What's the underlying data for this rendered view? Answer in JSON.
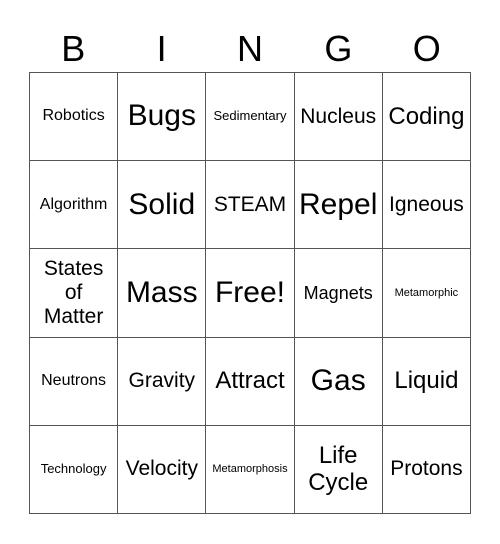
{
  "header": [
    "B",
    "I",
    "N",
    "G",
    "O"
  ],
  "cells": [
    {
      "text": "Robotics",
      "size": "s-md"
    },
    {
      "text": "Bugs",
      "size": "s-xxl"
    },
    {
      "text": "Sedimentary",
      "size": "s-sm"
    },
    {
      "text": "Nucleus",
      "size": "s-lg"
    },
    {
      "text": "Coding",
      "size": "s-xl"
    },
    {
      "text": "Algorithm",
      "size": "s-md"
    },
    {
      "text": "Solid",
      "size": "s-xxl"
    },
    {
      "text": "STEAM",
      "size": "s-lg"
    },
    {
      "text": "Repel",
      "size": "s-xxl"
    },
    {
      "text": "Igneous",
      "size": "s-lg"
    },
    {
      "text": "States of Matter",
      "size": "s-lg"
    },
    {
      "text": "Mass",
      "size": "s-xxl"
    },
    {
      "text": "Free!",
      "size": "s-xxl"
    },
    {
      "text": "Magnets",
      "size": "s-md2"
    },
    {
      "text": "Metamorphic",
      "size": "s-xs"
    },
    {
      "text": "Neutrons",
      "size": "s-md"
    },
    {
      "text": "Gravity",
      "size": "s-lg"
    },
    {
      "text": "Attract",
      "size": "s-xl"
    },
    {
      "text": "Gas",
      "size": "s-xxl"
    },
    {
      "text": "Liquid",
      "size": "s-xl"
    },
    {
      "text": "Technology",
      "size": "s-sm"
    },
    {
      "text": "Velocity",
      "size": "s-lg"
    },
    {
      "text": "Metamorphosis",
      "size": "s-xs"
    },
    {
      "text": "Life Cycle",
      "size": "s-xl"
    },
    {
      "text": "Protons",
      "size": "s-lg"
    }
  ]
}
